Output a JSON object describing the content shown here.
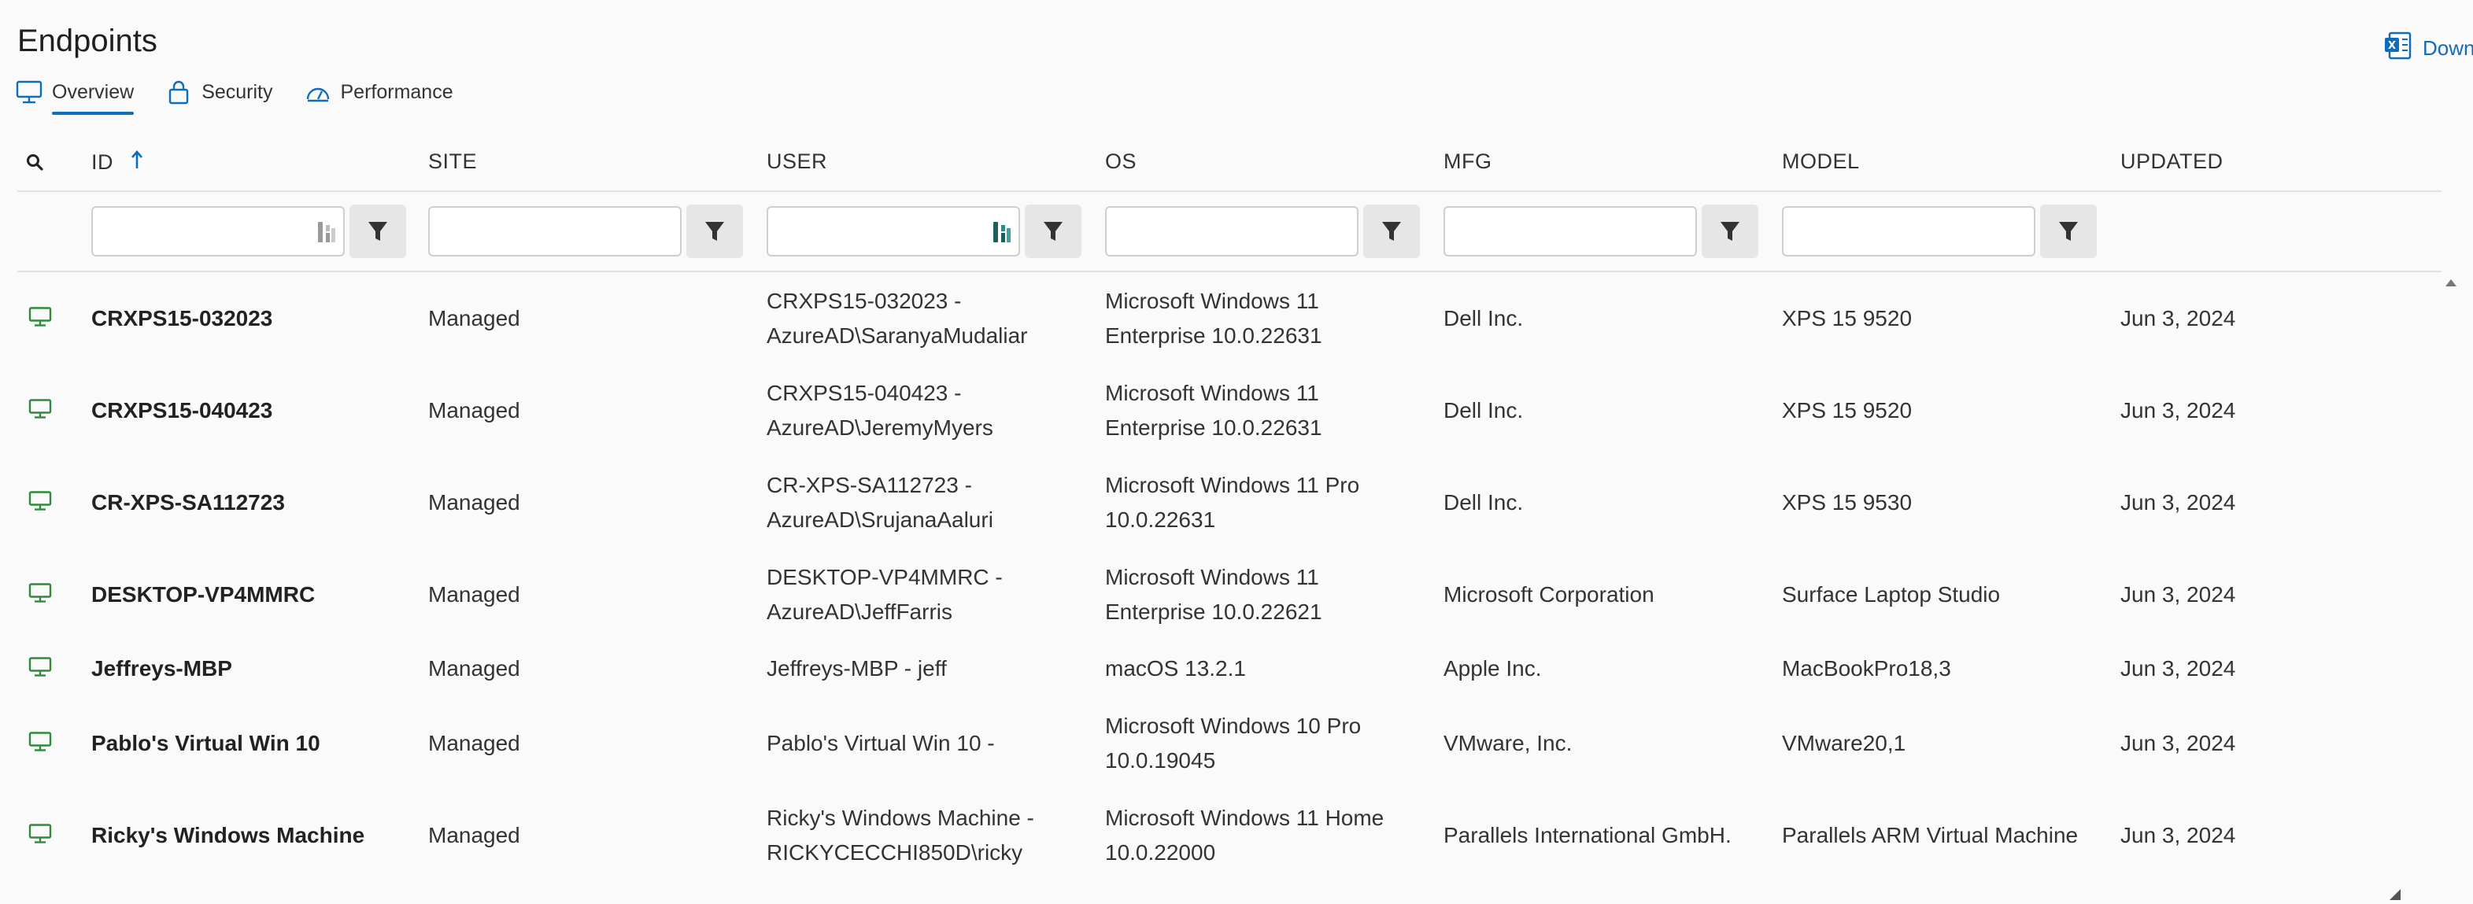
{
  "page": {
    "title": "Endpoints",
    "download_label": "Download"
  },
  "tabs": [
    {
      "label": "Overview",
      "icon": "monitor-icon",
      "active": true
    },
    {
      "label": "Security",
      "icon": "lock-icon",
      "active": false
    },
    {
      "label": "Performance",
      "icon": "gauge-icon",
      "active": false
    }
  ],
  "columns": {
    "id": "ID",
    "site": "SITE",
    "user": "USER",
    "os": "OS",
    "mfg": "MFG",
    "model": "MODEL",
    "updated": "UPDATED"
  },
  "sort": {
    "column": "ID",
    "direction": "ascending"
  },
  "filters": {
    "id": {
      "value": "",
      "placeholder": ""
    },
    "site": {
      "value": "",
      "placeholder": ""
    },
    "user": {
      "value": "",
      "placeholder": ""
    },
    "os": {
      "value": "",
      "placeholder": ""
    },
    "mfg": {
      "value": "",
      "placeholder": ""
    },
    "model": {
      "value": "",
      "placeholder": ""
    }
  },
  "rows": [
    {
      "id": "CRXPS15-032023",
      "site": "Managed",
      "user": "CRXPS15-032023 -\nAzureAD\\SaranyaMudaliar",
      "os": "Microsoft Windows 11\nEnterprise 10.0.22631",
      "mfg": "Dell Inc.",
      "model": "XPS 15 9520",
      "updated": "Jun 3, 2024"
    },
    {
      "id": "CRXPS15-040423",
      "site": "Managed",
      "user": "CRXPS15-040423 -\nAzureAD\\JeremyMyers",
      "os": "Microsoft Windows 11\nEnterprise 10.0.22631",
      "mfg": "Dell Inc.",
      "model": "XPS 15 9520",
      "updated": "Jun 3, 2024"
    },
    {
      "id": "CR-XPS-SA112723",
      "site": "Managed",
      "user": "CR-XPS-SA112723 -\nAzureAD\\SrujanaAaluri",
      "os": "Microsoft Windows 11 Pro\n10.0.22631",
      "mfg": "Dell Inc.",
      "model": "XPS 15 9530",
      "updated": "Jun 3, 2024"
    },
    {
      "id": "DESKTOP-VP4MMRC",
      "site": "Managed",
      "user": "DESKTOP-VP4MMRC -\nAzureAD\\JeffFarris",
      "os": "Microsoft Windows 11\nEnterprise 10.0.22621",
      "mfg": "Microsoft Corporation",
      "model": "Surface Laptop Studio",
      "updated": "Jun 3, 2024"
    },
    {
      "id": "Jeffreys-MBP",
      "site": "Managed",
      "user": "Jeffreys-MBP - jeff",
      "os": "macOS 13.2.1",
      "mfg": "Apple Inc.",
      "model": "MacBookPro18,3",
      "updated": "Jun 3, 2024"
    },
    {
      "id": "Pablo's Virtual Win 10",
      "site": "Managed",
      "user": "Pablo's Virtual Win 10 -",
      "os": "Microsoft Windows 10 Pro\n10.0.19045",
      "mfg": "VMware, Inc.",
      "model": "VMware20,1",
      "updated": "Jun 3, 2024"
    },
    {
      "id": "Ricky's Windows Machine",
      "site": "Managed",
      "user": "Ricky's Windows Machine -\nRICKYCECCHI850D\\ricky",
      "os": "Microsoft Windows 11 Home\n10.0.22000",
      "mfg": "Parallels International GmbH.",
      "model": "Parallels ARM Virtual Machine",
      "updated": "Jun 3, 2024"
    }
  ],
  "colors": {
    "accent": "#0f6cbd",
    "device_icon": "#2e8b3a",
    "filter_button_bg": "#e6e6e6"
  }
}
